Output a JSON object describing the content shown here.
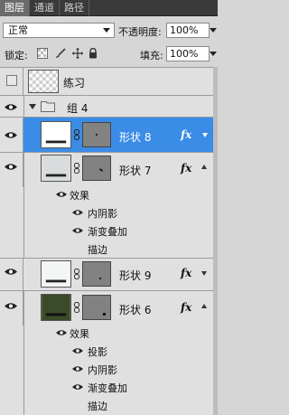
{
  "tabs": [
    {
      "label": "图层",
      "active": true
    },
    {
      "label": "通道",
      "active": false
    },
    {
      "label": "路径",
      "active": false
    }
  ],
  "controls": {
    "blend_mode": "正常",
    "opacity_label": "不透明度:",
    "opacity_value": "100%",
    "lock_label": "锁定:",
    "fill_label": "填充:",
    "fill_value": "100%"
  },
  "layers": {
    "practice_name": "练习",
    "group_name": "组 4",
    "shape8": {
      "name": "形状 8",
      "fx": "fx"
    },
    "shape7": {
      "name": "形状 7",
      "fx": "fx",
      "effects_label": "效果",
      "effects": [
        "内阴影",
        "渐变叠加",
        "描边"
      ]
    },
    "shape9": {
      "name": "形状 9",
      "fx": "fx"
    },
    "shape6": {
      "name": "形状 6",
      "fx": "fx",
      "effects_label": "效果",
      "effects": [
        "投影",
        "内阴影",
        "渐变叠加",
        "描边"
      ]
    }
  },
  "colors": {
    "selected": "#3a8ce6",
    "shape6_thumb": "#3b4a2a",
    "mask_gray": "#828282"
  }
}
